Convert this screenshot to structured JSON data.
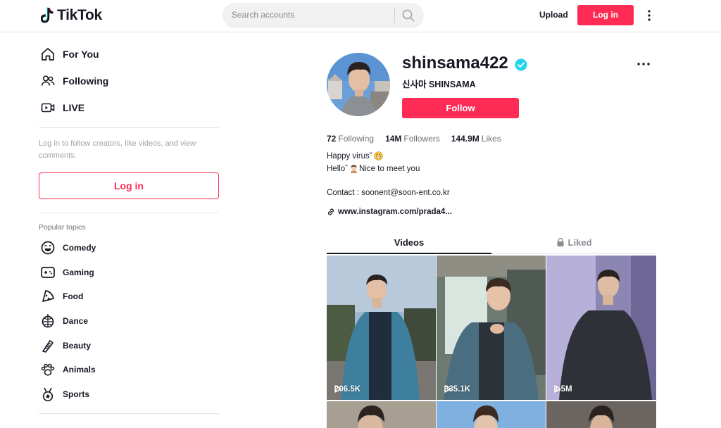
{
  "header": {
    "logo_text": "TikTok",
    "search_placeholder": "Search accounts",
    "upload_label": "Upload",
    "login_label": "Log in"
  },
  "sidebar": {
    "nav": [
      {
        "label": "For You",
        "icon": "home-icon"
      },
      {
        "label": "Following",
        "icon": "following-icon"
      },
      {
        "label": "LIVE",
        "icon": "live-icon"
      }
    ],
    "login_hint": "Log in to follow creators, like videos, and view comments.",
    "login_label": "Log in",
    "topics_title": "Popular topics",
    "topics": [
      {
        "label": "Comedy",
        "icon": "comedy-icon"
      },
      {
        "label": "Gaming",
        "icon": "gaming-icon"
      },
      {
        "label": "Food",
        "icon": "food-icon"
      },
      {
        "label": "Dance",
        "icon": "dance-icon"
      },
      {
        "label": "Beauty",
        "icon": "beauty-icon"
      },
      {
        "label": "Animals",
        "icon": "animals-icon"
      },
      {
        "label": "Sports",
        "icon": "sports-icon"
      }
    ]
  },
  "profile": {
    "username": "shinsama422",
    "display_name": "신사마 SHINSAMA",
    "follow_label": "Follow",
    "stats": [
      {
        "value": "72",
        "label": "Following"
      },
      {
        "value": "14M",
        "label": "Followers"
      },
      {
        "value": "144.9M",
        "label": "Likes"
      }
    ],
    "bio_line1": "Happy virus˘",
    "bio_line2_a": "Hello˘",
    "bio_line2_b": " Nice to meet you",
    "contact": "Contact : soonent@soon-ent.co.kr",
    "link": "www.instagram.com/prada4..."
  },
  "tabs": {
    "videos": "Videos",
    "liked": "Liked"
  },
  "videos": [
    {
      "views": "206.5K"
    },
    {
      "views": "335.1K"
    },
    {
      "views": "1.5M"
    }
  ],
  "colors": {
    "brand": "#fe2c55",
    "verified": "#20d5ec"
  }
}
